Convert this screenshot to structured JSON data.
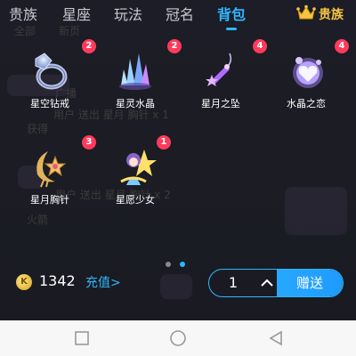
{
  "tabs": [
    {
      "label": "贵族",
      "active": false
    },
    {
      "label": "星座",
      "active": false
    },
    {
      "label": "玩法",
      "active": false
    },
    {
      "label": "冠名",
      "active": false
    },
    {
      "label": "背包",
      "active": true
    }
  ],
  "noble": {
    "label": "贵族",
    "icon": "crown-icon"
  },
  "items": [
    {
      "name": "星空钻戒",
      "count": "2",
      "icon": "ring-icon"
    },
    {
      "name": "星灵水晶",
      "count": "2",
      "icon": "crystal-icon"
    },
    {
      "name": "星月之坠",
      "count": "4",
      "icon": "pendant-icon"
    },
    {
      "name": "水晶之恋",
      "count": "4",
      "icon": "crystal-heart-icon"
    },
    {
      "name": "星月胸针",
      "count": "3",
      "icon": "brooch-icon"
    },
    {
      "name": "星愿少女",
      "count": "1",
      "icon": "girl-star-icon"
    }
  ],
  "pager": {
    "pages": 2,
    "active": 2
  },
  "wallet": {
    "coin_glyph": "K",
    "balance": "1342",
    "recharge_label": "充值>"
  },
  "quantity": {
    "value": "1"
  },
  "send_label": "赠送",
  "colors": {
    "accent": "#2fb7ff",
    "badge": "#ff3b5c",
    "gold": "#f5c542"
  },
  "background_ghost_text": [
    "全部",
    "新页",
    "用户 送出 星月 胸针 x 1",
    "获得",
    "广播",
    "用户 送出 星月 胸针 x 2",
    "火箭"
  ]
}
